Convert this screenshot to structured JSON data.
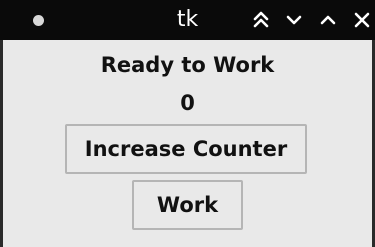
{
  "window": {
    "title": "tk",
    "controls": {
      "close_icon": "circle-close-icon",
      "shade_icon": "double-chevron-up-icon",
      "minimize_icon": "chevron-down-icon",
      "maximize_icon": "chevron-up-icon",
      "dismiss_icon": "x-icon"
    }
  },
  "main": {
    "status_label": "Ready to Work",
    "counter_value": "0",
    "increase_button_label": "Increase Counter",
    "work_button_label": "Work"
  },
  "colors": {
    "titlebar": "#0a0a0a",
    "content_background": "#e9e9e9",
    "button_border": "#b5b5b5",
    "text": "#111111"
  }
}
